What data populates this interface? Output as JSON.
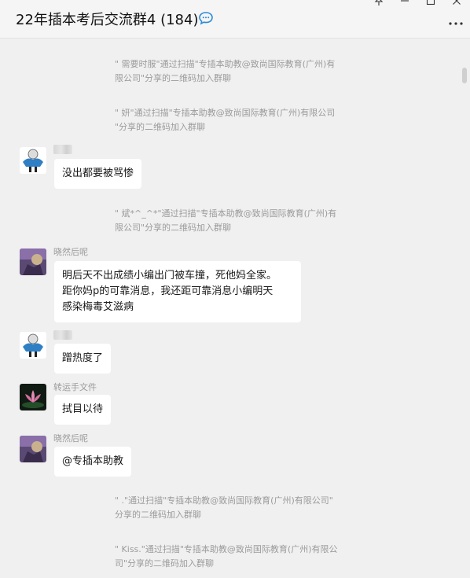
{
  "header": {
    "title": "22年插本考后交流群4 (184)",
    "window_controls": [
      "pin-icon",
      "minimize-icon",
      "maximize-icon",
      "close-icon"
    ],
    "more_icon": "more-icon"
  },
  "messages": [
    {
      "type": "system",
      "lines": [
        "\" 需要时服\"通过扫描\"专插本助教@致尚国际教育(广州)有",
        "限公司\"分享的二维码加入群聊"
      ]
    },
    {
      "type": "system",
      "lines": [
        "\" 妍\"通过扫描\"专插本助教@致尚国际教育(广州)有限公司",
        "\"分享的二维码加入群聊"
      ]
    },
    {
      "type": "chat",
      "sender": "",
      "avatar": "blue-cartoon-avatar",
      "lines": [
        "没出都要被骂惨"
      ]
    },
    {
      "type": "system",
      "lines": [
        "\" 斌*^_^*\"通过扫描\"专插本助教@致尚国际教育(广州)有",
        "限公司\"分享的二维码加入群聊"
      ]
    },
    {
      "type": "chat",
      "sender": "晓然后呢",
      "avatar": "purple-photo-avatar",
      "lines": [
        "明后天不出成绩小编出门被车撞，死他妈全家。",
        "距你妈p的可靠消息，我还距可靠消息小编明天",
        "感染梅毒艾滋病"
      ]
    },
    {
      "type": "chat",
      "sender": "",
      "avatar": "blue-cartoon-avatar",
      "lines": [
        "蹭热度了"
      ]
    },
    {
      "type": "chat",
      "sender": "转运手文件",
      "avatar": "lotus-avatar",
      "lines": [
        "拭目以待"
      ]
    },
    {
      "type": "chat",
      "sender": "晓然后呢",
      "avatar": "purple-photo-avatar",
      "lines": [
        "@专插本助教"
      ]
    },
    {
      "type": "system",
      "lines": [
        "\" .\"通过扫描\"专插本助教@致尚国际教育(广州)有限公司\"",
        "分享的二维码加入群聊"
      ]
    },
    {
      "type": "system",
      "lines": [
        "\" Kiss.\"通过扫描\"专插本助教@致尚国际教育(广州)有限公",
        "司\"分享的二维码加入群聊"
      ]
    }
  ],
  "colors": {
    "background": "#f0f0f0",
    "bubble": "#ffffff",
    "system_text": "#9b9b9b",
    "chat_icon": "#07c160"
  }
}
